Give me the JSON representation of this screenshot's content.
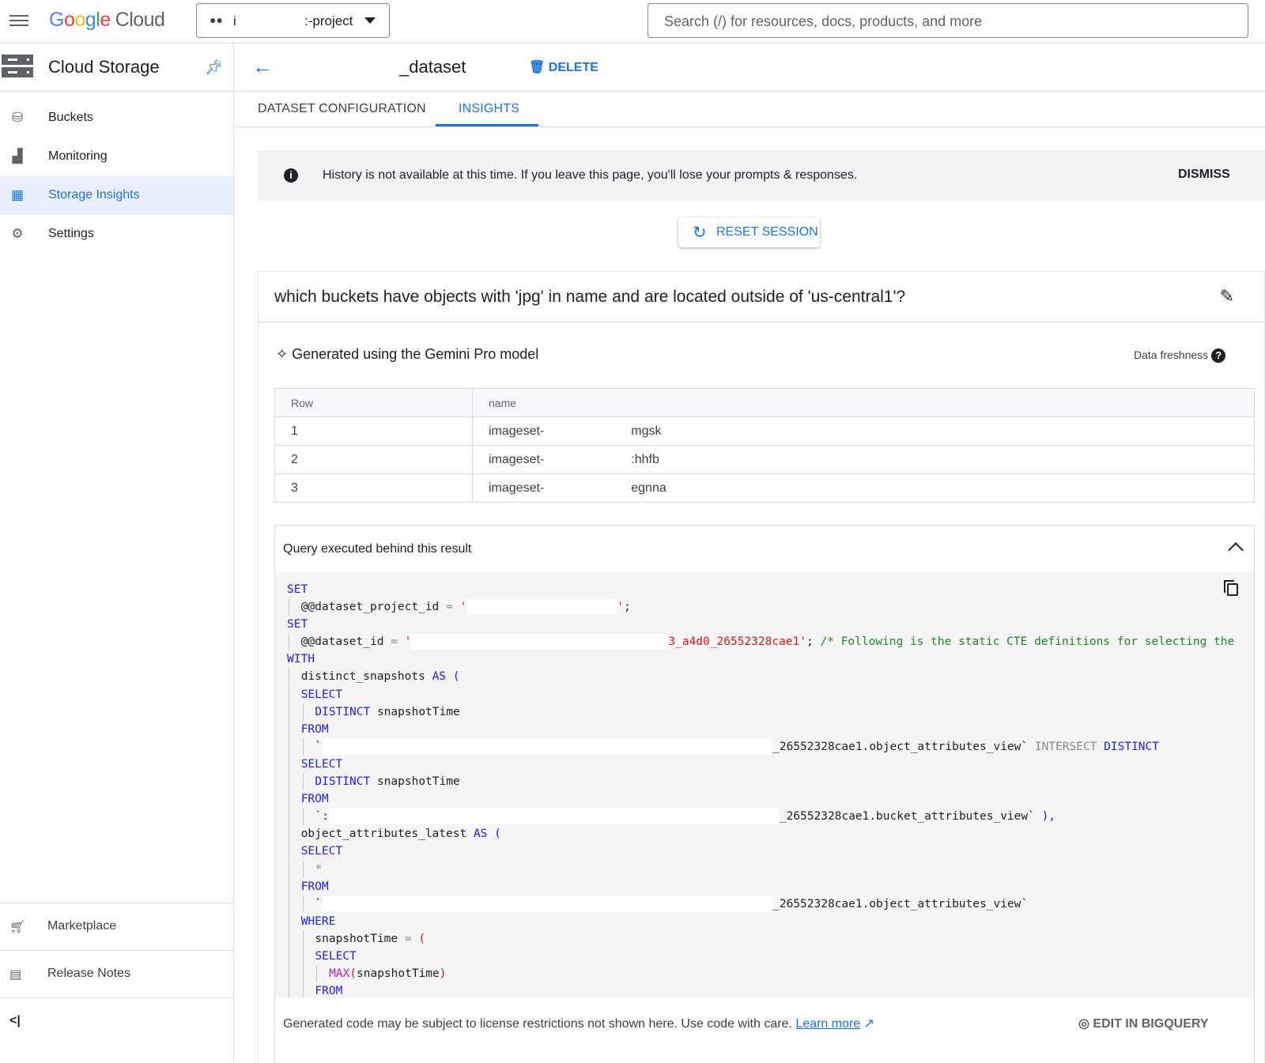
{
  "topbar": {
    "logo": "Google",
    "logo_suffix": "Cloud",
    "project_prefix": "i",
    "project_suffix": ":-project",
    "search_placeholder": "Search (/) for resources, docs, products, and more"
  },
  "sidebar": {
    "title": "Cloud Storage",
    "items": [
      {
        "label": "Buckets",
        "icon": "bucket-icon"
      },
      {
        "label": "Monitoring",
        "icon": "chart-icon"
      },
      {
        "label": "Storage Insights",
        "icon": "insights-icon",
        "active": true
      },
      {
        "label": "Settings",
        "icon": "gear-icon"
      }
    ],
    "footer": [
      {
        "label": "Marketplace",
        "icon": "cart-icon"
      },
      {
        "label": "Release Notes",
        "icon": "notes-icon"
      }
    ]
  },
  "header": {
    "title": "_dataset",
    "delete_label": "DELETE"
  },
  "tabs": [
    {
      "label": "DATASET CONFIGURATION"
    },
    {
      "label": "INSIGHTS",
      "active": true
    }
  ],
  "banner": {
    "message": "History is not available at this time. If you leave this page, you'll lose your prompts & responses.",
    "dismiss": "DISMISS"
  },
  "reset_label": "RESET SESSION",
  "question": "which buckets have objects with 'jpg' in name and are located outside of 'us-central1'?",
  "generated_by": "Generated using the Gemini Pro model",
  "data_freshness": "Data freshness",
  "results": {
    "columns": [
      "Row",
      "name"
    ],
    "rows": [
      {
        "row": "1",
        "name_prefix": "imageset-",
        "name_suffix": "mgsk"
      },
      {
        "row": "2",
        "name_prefix": "imageset-",
        "name_suffix": ":hhfb"
      },
      {
        "row": "3",
        "name_prefix": "imageset-",
        "name_suffix": "egnna"
      }
    ]
  },
  "query": {
    "heading": "Query executed behind this result",
    "lines": [
      {
        "i": 0,
        "t": [
          [
            "kw",
            "SET"
          ]
        ]
      },
      {
        "i": 1,
        "t": [
          [
            "tx",
            "@@dataset_project_id "
          ],
          [
            "op",
            "= "
          ],
          [
            "str",
            "'"
          ],
          [
            "redact",
            ""
          ],
          [
            "str",
            "'"
          ],
          [
            "tx",
            ";"
          ]
        ]
      },
      {
        "i": 0,
        "t": [
          [
            "kw",
            "SET"
          ]
        ]
      },
      {
        "i": 1,
        "t": [
          [
            "tx",
            "@@dataset_id "
          ],
          [
            "op",
            "= "
          ],
          [
            "str",
            "'"
          ],
          [
            "redact",
            ""
          ],
          [
            "str",
            "3_a4d0_26552328cae1'"
          ],
          [
            "tx",
            "; "
          ],
          [
            "cm",
            "/* Following is the static CTE definitions for selecting the"
          ]
        ]
      },
      {
        "i": 0,
        "t": [
          [
            "kw",
            "WITH"
          ]
        ]
      },
      {
        "i": 1,
        "t": [
          [
            "tx",
            "distinct_snapshots "
          ],
          [
            "kw",
            "AS ("
          ]
        ]
      },
      {
        "i": 1,
        "t": [
          [
            "kw",
            "SELECT"
          ]
        ]
      },
      {
        "i": 2,
        "t": [
          [
            "kw",
            "DISTINCT "
          ],
          [
            "tx",
            "snapshotTime"
          ]
        ]
      },
      {
        "i": 1,
        "t": [
          [
            "kw",
            "FROM"
          ]
        ]
      },
      {
        "i": 2,
        "t": [
          [
            "tx",
            "`"
          ],
          [
            "redact",
            ""
          ],
          [
            "tx",
            "_26552328cae1.object_attributes_view` "
          ],
          [
            "op",
            "INTERSECT "
          ],
          [
            "kw",
            "DISTINCT"
          ]
        ]
      },
      {
        "i": 1,
        "t": [
          [
            "kw",
            "SELECT"
          ]
        ]
      },
      {
        "i": 2,
        "t": [
          [
            "kw",
            "DISTINCT "
          ],
          [
            "tx",
            "snapshotTime"
          ]
        ]
      },
      {
        "i": 1,
        "t": [
          [
            "kw",
            "FROM"
          ]
        ]
      },
      {
        "i": 2,
        "t": [
          [
            "tx",
            "`:"
          ],
          [
            "redact",
            ""
          ],
          [
            "tx",
            "_26552328cae1.bucket_attributes_view` "
          ],
          [
            "kw",
            "),"
          ]
        ]
      },
      {
        "i": 1,
        "t": [
          [
            "tx",
            "object_attributes_latest "
          ],
          [
            "kw",
            "AS ("
          ]
        ]
      },
      {
        "i": 1,
        "t": [
          [
            "kw",
            "SELECT"
          ]
        ]
      },
      {
        "i": 2,
        "t": [
          [
            "op",
            "*"
          ]
        ]
      },
      {
        "i": 1,
        "t": [
          [
            "kw",
            "FROM"
          ]
        ]
      },
      {
        "i": 2,
        "t": [
          [
            "tx",
            "`"
          ],
          [
            "redact",
            ""
          ],
          [
            "tx",
            "_26552328cae1.object_attributes_view`"
          ]
        ]
      },
      {
        "i": 1,
        "t": [
          [
            "kw",
            "WHERE"
          ]
        ]
      },
      {
        "i": 2,
        "t": [
          [
            "tx",
            "snapshotTime "
          ],
          [
            "op",
            "= "
          ],
          [
            "str",
            "("
          ]
        ]
      },
      {
        "i": 2,
        "t": [
          [
            "kw",
            "SELECT"
          ]
        ]
      },
      {
        "i": 3,
        "t": [
          [
            "fn",
            "MAX"
          ],
          [
            "str",
            "("
          ],
          [
            "tx",
            "snapshotTime"
          ],
          [
            "str",
            ")"
          ]
        ]
      },
      {
        "i": 2,
        "t": [
          [
            "kw",
            "FROM"
          ]
        ]
      }
    ]
  },
  "footer": {
    "notice": "Generated code may be subject to license restrictions not shown here. Use code with care.",
    "learn_more": "Learn more",
    "edit_bq": "EDIT IN BIGQUERY"
  },
  "colors": {
    "accent": "#1a73e8",
    "keyword": "#1a1aff",
    "string": "#e01515",
    "comment": "#1d8a1d"
  }
}
